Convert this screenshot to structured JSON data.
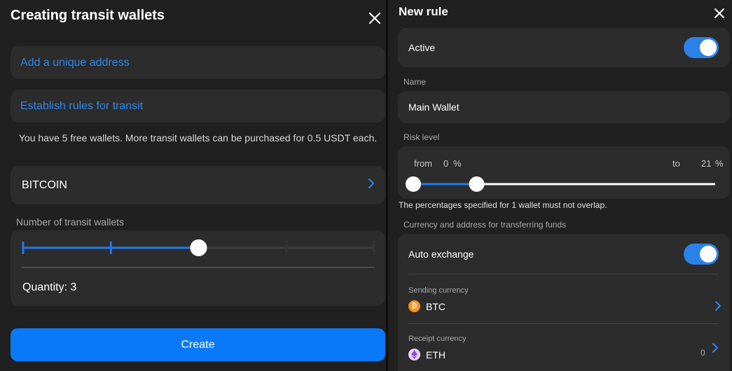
{
  "left_panel": {
    "title": "Creating transit wallets",
    "add_address_label": "Add a unique address",
    "establish_rules_label": "Establish rules for transit",
    "info_text": "You have 5 free wallets. More transit wallets can be purchased for 0.5 USDT each.",
    "coin_label": "BITCOIN",
    "slider_label": "Number of transit wallets",
    "quantity_text": "Quantity: 3",
    "quantity_value": 3,
    "slider_max": 5,
    "create_label": "Create"
  },
  "right_panel": {
    "title": "New rule",
    "active_label": "Active",
    "active_on": true,
    "name_label": "Name",
    "name_value": "Main Wallet",
    "risk_label": "Risk level",
    "risk_from_label": "from",
    "risk_from_value": "0",
    "risk_to_label": "to",
    "risk_to_value": "21",
    "percent_sign": "%",
    "risk_from": 0,
    "risk_to": 21,
    "risk_note": "The percentages specified for 1 wallet must not overlap.",
    "currency_section_label": "Currency and address for transferring funds",
    "auto_exchange_label": "Auto exchange",
    "auto_exchange_on": true,
    "sending_label": "Sending currency",
    "sending_value": "BTC",
    "receipt_label": "Receipt currency",
    "receipt_value": "ETH",
    "receipt_count": "0"
  },
  "colors": {
    "accent": "#0a79f8",
    "link": "#2f87e8",
    "btc": "#f7931a",
    "eth": "#c99df0"
  }
}
